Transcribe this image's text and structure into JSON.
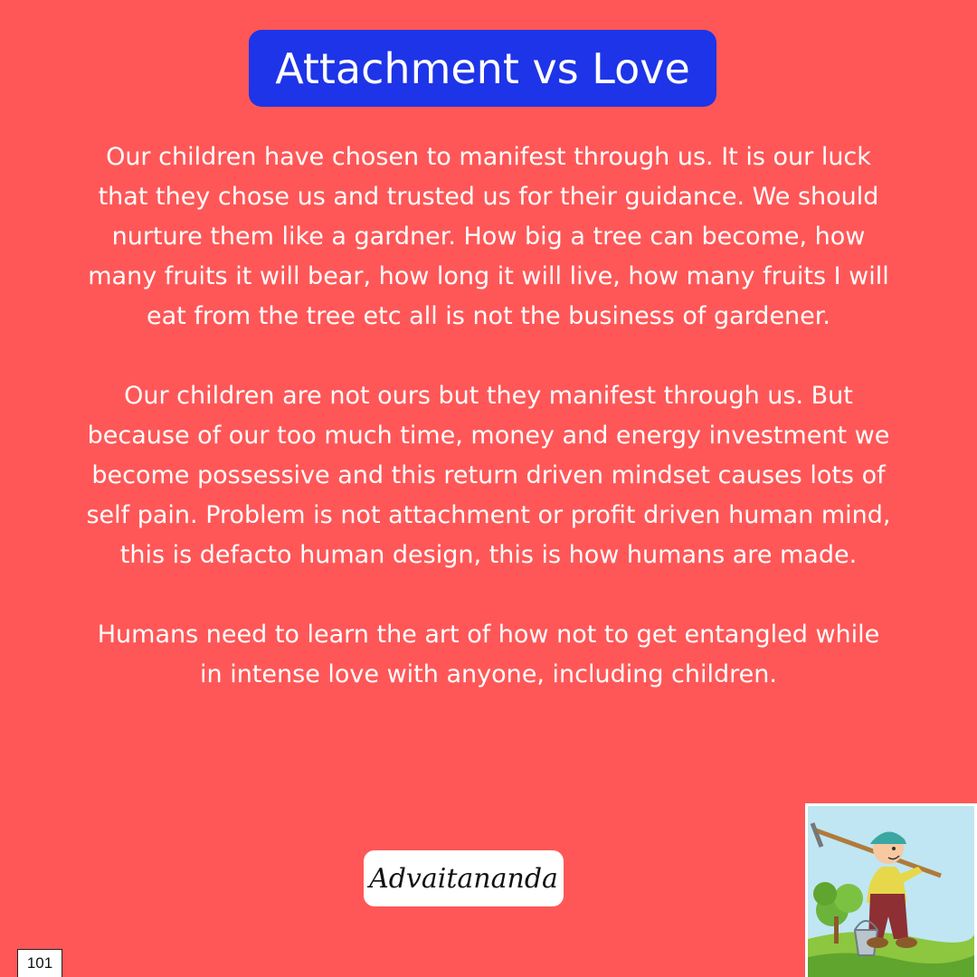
{
  "title": "Attachment vs Love",
  "paragraphs": [
    "Our children have chosen to manifest through us. It is our luck that they chose us and trusted us for their guidance. We should nurture them like a gardner. How big a tree can become, how many fruits it will bear, how long it will live, how many fruits I will eat from the tree etc all is not the business of gardener.",
    "Our children are not ours but they manifest through us. But because of our too much time, money and energy investment we become possessive and this return driven mindset causes lots of self pain. Problem is not attachment or profit driven human mind, this is defacto human design, this is how humans are made.",
    "Humans need to learn the art of how not to get entangled while in intense love with anyone, including children."
  ],
  "signature": "Advaitananda",
  "page_number": "101",
  "illustration": "gardener-with-rake-and-bucket",
  "colors": {
    "background": "#FF5757",
    "title_box": "#1E34E8",
    "text": "#FFFFFF"
  }
}
